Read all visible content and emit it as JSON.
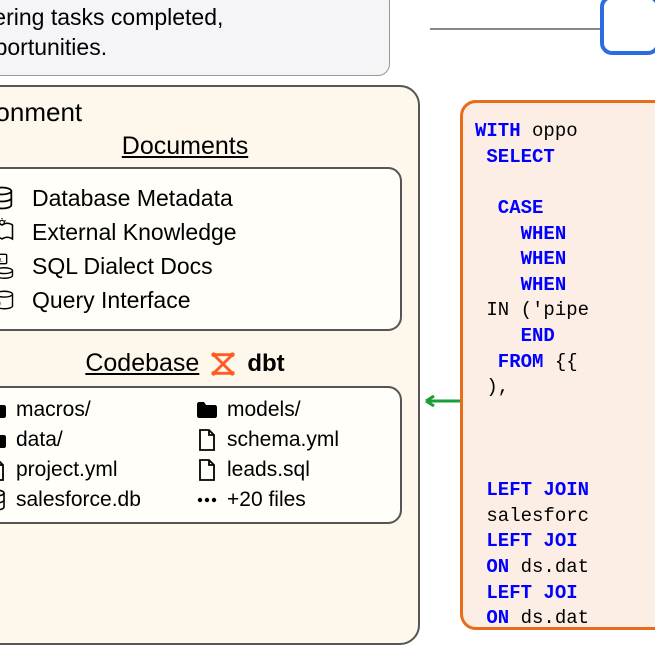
{
  "task": {
    "line1": "overing tasks completed,",
    "line2": "opportunities."
  },
  "env": {
    "title": "vironment",
    "docs_title": "Documents",
    "docs": [
      "Database Metadata",
      "External Knowledge",
      "SQL Dialect Docs",
      "Query Interface"
    ],
    "code_title": "Codebase",
    "dbt": "dbt",
    "files": [
      {
        "icon": "folder",
        "name": "macros/"
      },
      {
        "icon": "folder",
        "name": "models/"
      },
      {
        "icon": "folder",
        "name": "data/"
      },
      {
        "icon": "file",
        "name": "schema.yml"
      },
      {
        "icon": "file",
        "name": "project.yml"
      },
      {
        "icon": "file",
        "name": "leads.sql"
      },
      {
        "icon": "db",
        "name": "salesforce.db"
      },
      {
        "icon": "dots",
        "name": "+20 files"
      }
    ]
  },
  "sql": {
    "l1a": "WITH",
    "l1b": " oppo",
    "l2": " SELECT",
    "l3": "  CASE",
    "l4": "    WHEN",
    "l5": "    WHEN",
    "l6": "    WHEN",
    "l7a": " IN",
    "l7b": " ('pipe",
    "l8": "    END",
    "l9a": "  FROM",
    "l9b": " {{",
    "l10": " ),",
    "l11a": " LEFT JOIN",
    "l12": " salesforc",
    "l13a": " LEFT JOI",
    "l14a": " ON",
    "l14b": " ds.dat",
    "l15a": " LEFT JOI",
    "l16a": " ON",
    "l16b": " ds.dat"
  }
}
